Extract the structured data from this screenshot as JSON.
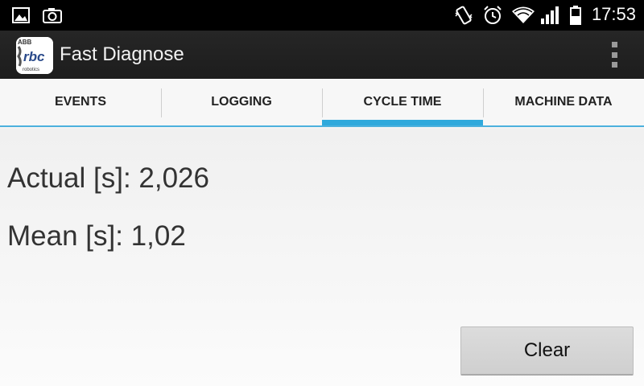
{
  "status_bar": {
    "time": "17:53",
    "icons": [
      "image-icon",
      "camera-icon",
      "vibrate-icon",
      "alarm-icon",
      "wifi-icon",
      "signal-icon",
      "battery-icon"
    ]
  },
  "action_bar": {
    "app_logo_text": "rbc",
    "app_logo_top_text": "ABB",
    "app_logo_bottom_text": "robotics",
    "title": "Fast Diagnose",
    "overflow_icon": "overflow-menu-icon"
  },
  "tabs": [
    {
      "label": "EVENTS",
      "active": false
    },
    {
      "label": "LOGGING",
      "active": false
    },
    {
      "label": "CYCLE TIME",
      "active": true
    },
    {
      "label": "MACHINE DATA",
      "active": false
    }
  ],
  "cycle_time": {
    "actual": "Actual [s]: 2,026",
    "mean": "Mean [s]: 1,02",
    "clear_label": "Clear"
  },
  "colors": {
    "accent": "#2fa9dc",
    "status_bar": "#000000",
    "action_bar": "#222222"
  }
}
